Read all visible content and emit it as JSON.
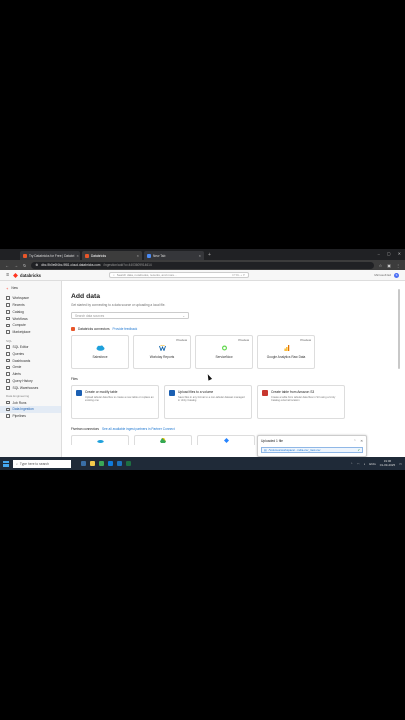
{
  "browser": {
    "tabs": [
      {
        "label": "Try Databricks for Free | Databri"
      },
      {
        "label": "Databricks"
      },
      {
        "label": "New Tab"
      }
    ],
    "url_host": "dbc-9b0e6f4bc-9f81.cloud.databricks.com",
    "url_path": "/ingestion/add?o=4403609914614"
  },
  "header": {
    "logo_text": "databricks",
    "search_placeholder": "Search data, notebooks, recents, and more...",
    "search_shortcut": "CTRL + P",
    "workspace": "Microsoft Ed",
    "avatar_initial": "S"
  },
  "toast": {
    "text": "Uploaded phone-usage-india.csv_rtest.csv"
  },
  "sidebar": {
    "new_label": "New",
    "items": [
      {
        "label": "Workspace"
      },
      {
        "label": "Recents"
      },
      {
        "label": "Catalog"
      },
      {
        "label": "Workflows"
      },
      {
        "label": "Compute"
      },
      {
        "label": "Marketplace"
      }
    ],
    "sql_group": "SQL",
    "sql_items": [
      {
        "label": "SQL Editor"
      },
      {
        "label": "Queries"
      },
      {
        "label": "Dashboards"
      },
      {
        "label": "Genie"
      },
      {
        "label": "Alerts"
      },
      {
        "label": "Query History"
      },
      {
        "label": "SQL Warehouses"
      }
    ],
    "de_group": "Data Engineering",
    "de_items": [
      {
        "label": "Job Runs"
      },
      {
        "label": "Data Ingestion"
      },
      {
        "label": "Pipelines"
      }
    ]
  },
  "main": {
    "title": "Add data",
    "subtitle": "Get started by connecting to a data source or uploading a local file.",
    "search_placeholder": "Search data sources",
    "connectors_label": "Databricks connectors",
    "feedback_link": "Provide feedback",
    "connectors": [
      {
        "name": "Salesforce",
        "badge": ""
      },
      {
        "name": "Workday Reports",
        "badge": "Preview"
      },
      {
        "name": "ServiceNow",
        "badge": "Preview"
      },
      {
        "name": "Google Analytics Raw Data",
        "badge": "Preview"
      }
    ],
    "files_label": "Files",
    "files": [
      {
        "title": "Create or modify table",
        "desc": "Upload tabular data files to create a new table or replace an existing one"
      },
      {
        "title": "Upload files to a volume",
        "desc": "Save files in any format to a non-tabular dataset managed in Unity Catalog"
      },
      {
        "title": "Create table from Amazon S3",
        "desc": "Create a table from tabular data files in S3 using a Unity Catalog external location"
      }
    ],
    "partner_label": "Fivetran connectors",
    "partner_link": "See all available ingest partners in Partner Connect"
  },
  "upload": {
    "title": "Uploaded 1 file",
    "file": "/Volumes/workspace/...india-csv_rtest.csv"
  },
  "taskbar": {
    "search": "Type here to search",
    "lang": "ENG",
    "time": "19:06",
    "date": "01-09-2025"
  },
  "colors": {
    "brand": "#ff3621",
    "link": "#1b75d0",
    "active_bg": "#e3ebf5"
  }
}
